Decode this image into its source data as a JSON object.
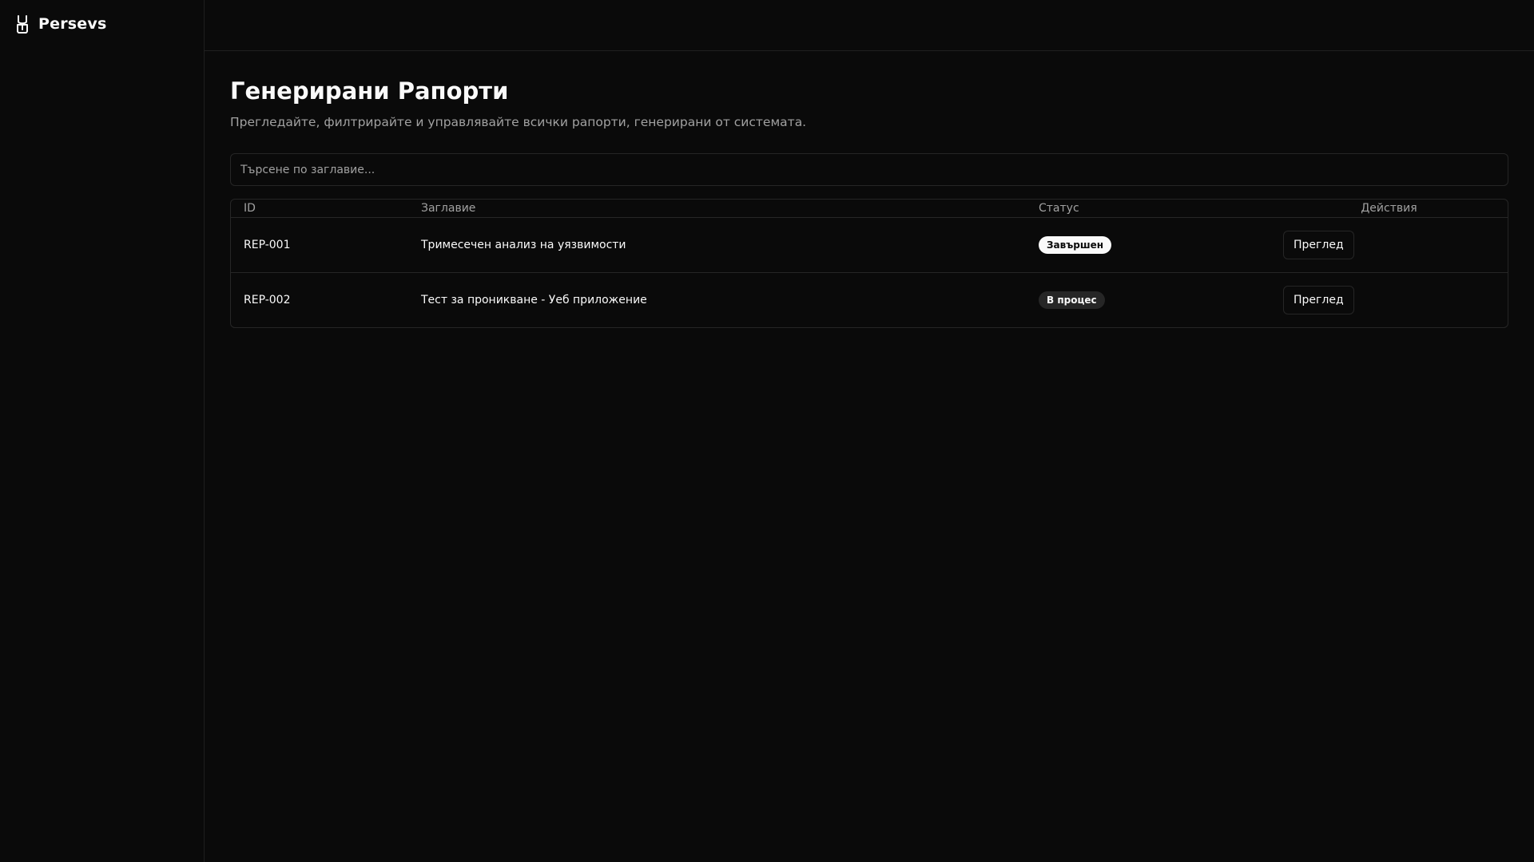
{
  "brand": {
    "name": "Persevs",
    "logo_icon": "helmet-icon"
  },
  "page": {
    "title": "Генерирани Рапорти",
    "subtitle": "Прегледайте, филтрирайте и управлявайте всички рапорти, генерирани от системата."
  },
  "search": {
    "placeholder": "Търсене по заглавие...",
    "value": ""
  },
  "table": {
    "columns": {
      "id": "ID",
      "title": "Заглавие",
      "status": "Статус",
      "actions": "Действия"
    },
    "rows": [
      {
        "id": "REP-001",
        "title": "Тримесечен анализ на уязвимости",
        "status": "Завършен",
        "action": "Преглед"
      },
      {
        "id": "REP-002",
        "title": "Тест за проникване - Уеб приложение",
        "status": "В процес",
        "action": "Преглед"
      }
    ]
  },
  "colors": {
    "background": "#0a0a0a",
    "border": "#262626",
    "text": "#fafafa",
    "muted_text": "#a1a1a1",
    "badge_done_bg": "#fafafa",
    "badge_progress_bg": "#262626"
  }
}
